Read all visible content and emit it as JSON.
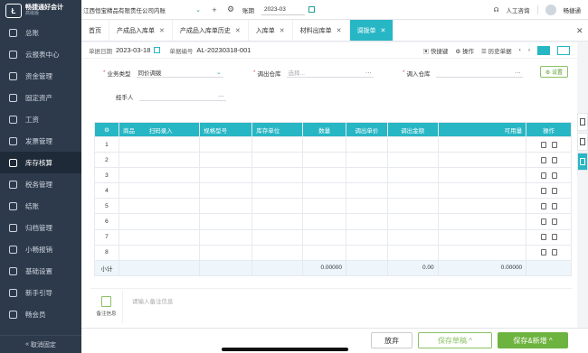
{
  "app": {
    "logo_mark": "Ł",
    "logo_title": "畅捷通好会计",
    "logo_sub": "高级版"
  },
  "sidebar": {
    "items": [
      {
        "label": "总账"
      },
      {
        "label": "云报表中心"
      },
      {
        "label": "资金管理"
      },
      {
        "label": "固定资产"
      },
      {
        "label": "工资"
      },
      {
        "label": "发票管理"
      },
      {
        "label": "库存核算"
      },
      {
        "label": "税务管理"
      },
      {
        "label": "结账"
      },
      {
        "label": "归档管理"
      },
      {
        "label": "小畅报销"
      },
      {
        "label": "基础设置"
      },
      {
        "label": "新手引导"
      },
      {
        "label": "畅会员"
      }
    ],
    "active_index": 6,
    "collapse_label": "取消固定"
  },
  "topbar": {
    "company": "江西恒宝精品有限责任公司内账",
    "period_label": "账期",
    "period_value": "2023-03",
    "support": "人工咨询",
    "user": "畅捷通"
  },
  "tabs": [
    {
      "label": "首页",
      "closable": false
    },
    {
      "label": "产成品入库单",
      "closable": true
    },
    {
      "label": "产成品入库单历史",
      "closable": true
    },
    {
      "label": "入库单",
      "closable": true
    },
    {
      "label": "材料出库单",
      "closable": true
    },
    {
      "label": "调拨单",
      "closable": true,
      "active": true
    }
  ],
  "doc": {
    "date_label": "单据日期",
    "date_value": "2023-03-18",
    "no_label": "单据编号",
    "no_value": "AL-20230318-001",
    "shortcut": "快捷键",
    "operations": "操作",
    "history": "历史单据"
  },
  "form": {
    "biz_type_label": "业务类型",
    "biz_type_value": "同价调拨",
    "out_wh_label": "调出仓库",
    "out_wh_placeholder": "选择...",
    "in_wh_label": "调入仓库",
    "handler_label": "经手人",
    "settings": "设置"
  },
  "table": {
    "headers": [
      "商品",
      "扫码录入",
      "规格型号",
      "库存单位",
      "数量",
      "调出单价",
      "调出金额",
      "可用量",
      "操作"
    ],
    "rows": [
      "1",
      "2",
      "3",
      "4",
      "5",
      "6",
      "7",
      "8"
    ],
    "total_label": "小计",
    "total_qty": "0.00000",
    "total_amount": "0.00",
    "total_available": "0.00000"
  },
  "memo": {
    "label": "备注信息",
    "placeholder": "请输入备注信息"
  },
  "footer": {
    "discard": "放弃",
    "save_draft": "保存草稿 ^",
    "save_add": "保存&新增 ^"
  },
  "colors": {
    "accent": "#27b6c4",
    "sidebar": "#2d3a4b",
    "green": "#6db33f"
  }
}
